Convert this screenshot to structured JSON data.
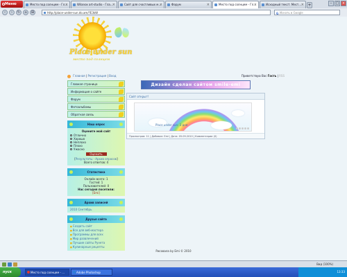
{
  "browser": {
    "menu_label": "Меню",
    "tabs": [
      {
        "label": "Место под солнцем - Гл...",
        "active": false
      },
      {
        "label": "Wilanox art-studio - Гла...",
        "active": false
      },
      {
        "label": "Сайт для счастливых м...",
        "active": false
      },
      {
        "label": "Форум",
        "active": false
      },
      {
        "label": "Место под солнцем - Гл...",
        "active": true
      },
      {
        "label": "Исходный текст: Мест...",
        "active": false
      }
    ],
    "address": "http://place-under-sun.do.am/?E3kW",
    "search_placeholder": "Искать в Google"
  },
  "site": {
    "logo_title": "Place under sun",
    "logo_subtitle": "место под солнцем",
    "top_links": {
      "home": "Главная",
      "register": "Регистрация",
      "login": "Вход"
    },
    "greeting_prefix": "Приветствую Вас",
    "greeting_user": "Гость",
    "rss": "RSS"
  },
  "menu": [
    "Главная страница",
    "Информация о сайте",
    "Форум",
    "Фотоальбомы",
    "Обратная связь"
  ],
  "poll": {
    "title": "Наш опрос",
    "question": "Оцените мой сайт",
    "options": [
      "Отлично",
      "Хорошо",
      "Неплохо",
      "Плохо",
      "Ужасно"
    ],
    "vote": "Оценить",
    "results": "Результаты",
    "archive": "Архив опросов",
    "total": "Всего ответов: 4"
  },
  "stats": {
    "title": "Статистика",
    "online": "Онлайн всего: 1",
    "guests": "Гостей: 1",
    "users": "Пользователей: 0",
    "today": "Нас сегодня посетили:",
    "today_user": "[Emi]"
  },
  "calendar": {
    "title": "Архив записей",
    "item": "2010 Сентябрь"
  },
  "friends": {
    "title": "Друзья сайта",
    "links": [
      "Создать сайт",
      "Все для веб-мастера",
      "Программы для всех",
      "Мир развлечений",
      "Лучшие сайты Рунета",
      "Кулинарные рецепты"
    ]
  },
  "main": {
    "banner": "Дизайн сделан сайтом smile-emi",
    "post_title": "Сайт открыт!",
    "post_caption": "Place under sun: 3 дня",
    "post_meta": "Просмотров: 11 | Добавил: Emi | Дата: 05.09.2010 | Комментарии (0)"
  },
  "footer": "Рисовала by Emi © 2010",
  "statusbar": {
    "zoom": "Вид (100%)"
  },
  "taskbar": {
    "start": "пуск",
    "tasks": [
      "Место под солнцем - ...",
      "Adobe Photoshop"
    ],
    "clock": "13:33"
  }
}
